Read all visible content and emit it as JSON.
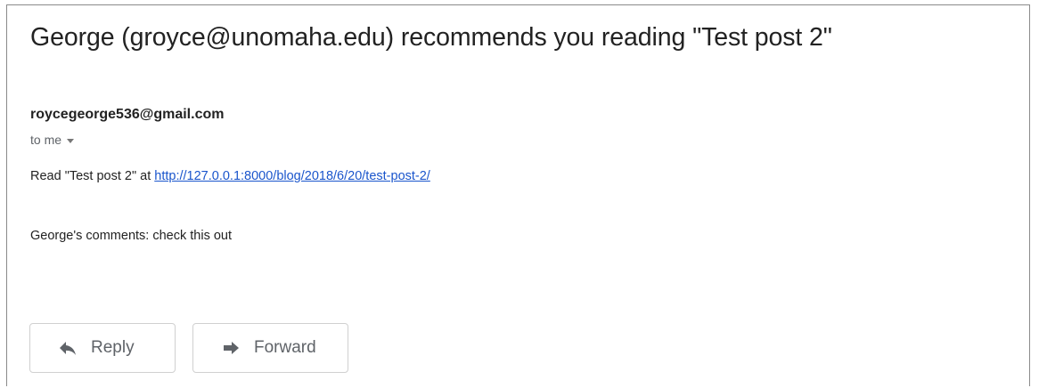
{
  "email": {
    "subject": "George (groyce@unomaha.edu) recommends you reading \"Test post 2\"",
    "sender": "roycegeorge536@gmail.com",
    "recipient_line": "to me",
    "body": {
      "read_prefix": "Read \"Test post 2\" at ",
      "link_text": "http://127.0.0.1:8000/blog/2018/6/20/test-post-2/",
      "comments": "George's comments: check this out"
    }
  },
  "actions": {
    "reply_label": "Reply",
    "reply_icon": "reply-arrow-icon",
    "forward_label": "Forward",
    "forward_icon": "forward-arrow-icon"
  }
}
